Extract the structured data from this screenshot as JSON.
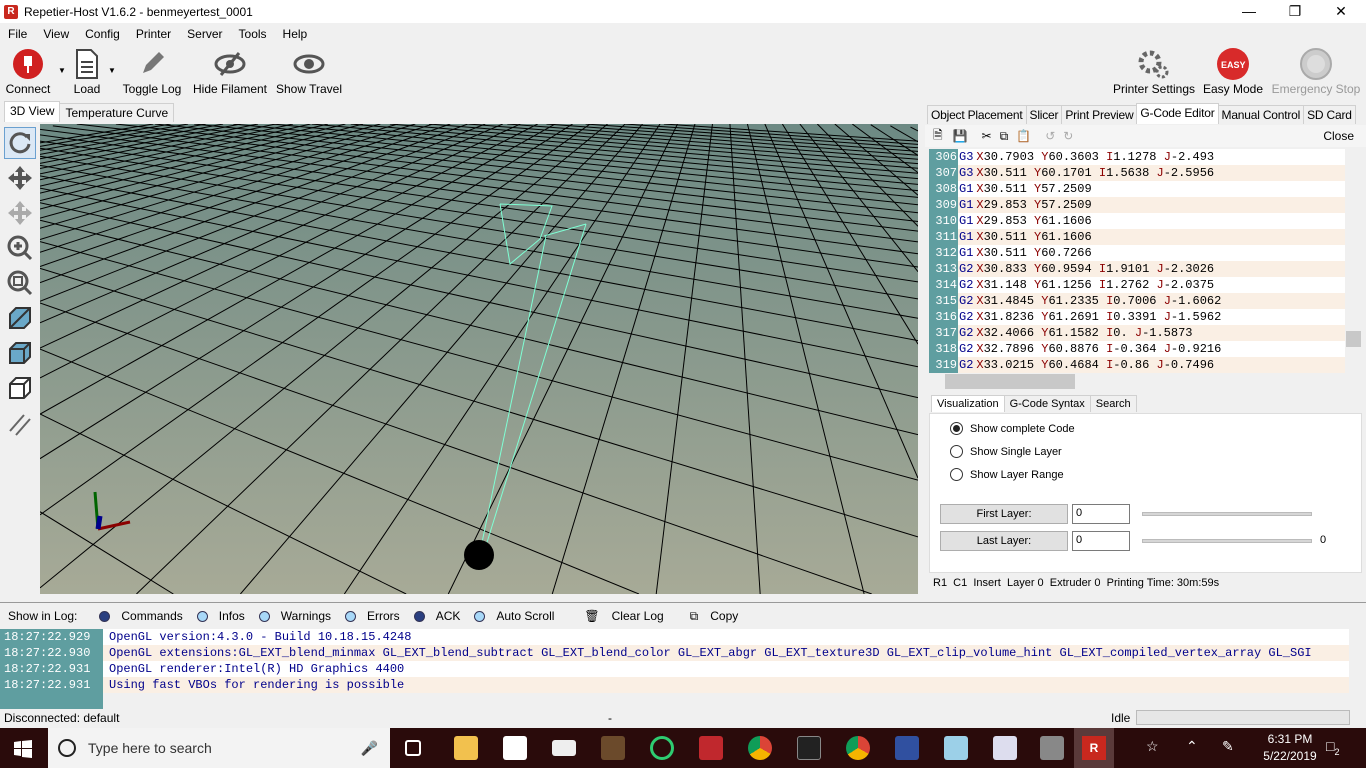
{
  "window": {
    "title": "Repetier-Host V1.6.2 - benmeyertest_0001",
    "app_icon": "R",
    "controls": [
      "minimize",
      "maximize",
      "close"
    ]
  },
  "menu": [
    "File",
    "View",
    "Config",
    "Printer",
    "Server",
    "Tools",
    "Help"
  ],
  "toolbar": {
    "connect": "Connect",
    "load": "Load",
    "toggle_log": "Toggle Log",
    "hide_filament": "Hide Filament",
    "show_travel": "Show Travel",
    "printer_settings": "Printer Settings",
    "easy_mode": "Easy Mode",
    "easy_badge": "EASY",
    "emergency_stop": "Emergency Stop"
  },
  "left_tabs": [
    "3D View",
    "Temperature Curve"
  ],
  "right_tabs": [
    "Object Placement",
    "Slicer",
    "Print Preview",
    "G-Code Editor",
    "Manual Control",
    "SD Card"
  ],
  "editor": {
    "close": "Close",
    "lines": [
      {
        "n": "306",
        "g": "G3",
        "p": [
          [
            "X",
            "30.7903"
          ],
          [
            "Y",
            "60.3603"
          ],
          [
            "I",
            "1.1278"
          ],
          [
            "J",
            "-2.493"
          ]
        ]
      },
      {
        "n": "307",
        "g": "G3",
        "p": [
          [
            "X",
            "30.511"
          ],
          [
            "Y",
            "60.1701"
          ],
          [
            "I",
            "1.5638"
          ],
          [
            "J",
            "-2.5956"
          ]
        ]
      },
      {
        "n": "308",
        "g": "G1",
        "p": [
          [
            "X",
            "30.511"
          ],
          [
            "Y",
            "57.2509"
          ]
        ]
      },
      {
        "n": "309",
        "g": "G1",
        "p": [
          [
            "X",
            "29.853"
          ],
          [
            "Y",
            "57.2509"
          ]
        ]
      },
      {
        "n": "310",
        "g": "G1",
        "p": [
          [
            "X",
            "29.853"
          ],
          [
            "Y",
            "61.1606"
          ]
        ]
      },
      {
        "n": "311",
        "g": "G1",
        "p": [
          [
            "X",
            "30.511"
          ],
          [
            "Y",
            "61.1606"
          ]
        ]
      },
      {
        "n": "312",
        "g": "G1",
        "p": [
          [
            "X",
            "30.511"
          ],
          [
            "Y",
            "60.7266"
          ]
        ]
      },
      {
        "n": "313",
        "g": "G2",
        "p": [
          [
            "X",
            "30.833"
          ],
          [
            "Y",
            "60.9594"
          ],
          [
            "I",
            "1.9101"
          ],
          [
            "J",
            "-2.3026"
          ]
        ]
      },
      {
        "n": "314",
        "g": "G2",
        "p": [
          [
            "X",
            "31.148"
          ],
          [
            "Y",
            "61.1256"
          ],
          [
            "I",
            "1.2762"
          ],
          [
            "J",
            "-2.0375"
          ]
        ]
      },
      {
        "n": "315",
        "g": "G2",
        "p": [
          [
            "X",
            "31.4845"
          ],
          [
            "Y",
            "61.2335"
          ],
          [
            "I",
            "0.7006"
          ],
          [
            "J",
            "-1.6062"
          ]
        ]
      },
      {
        "n": "316",
        "g": "G2",
        "p": [
          [
            "X",
            "31.8236"
          ],
          [
            "Y",
            "61.2691"
          ],
          [
            "I",
            "0.3391"
          ],
          [
            "J",
            "-1.5962"
          ]
        ]
      },
      {
        "n": "317",
        "g": "G2",
        "p": [
          [
            "X",
            "32.4066"
          ],
          [
            "Y",
            "61.1582"
          ],
          [
            "I",
            "0."
          ],
          [
            "J",
            "-1.5873"
          ]
        ]
      },
      {
        "n": "318",
        "g": "G2",
        "p": [
          [
            "X",
            "32.7896"
          ],
          [
            "Y",
            "60.8876"
          ],
          [
            "I",
            "-0.364"
          ],
          [
            "J",
            "-0.9216"
          ]
        ]
      },
      {
        "n": "319",
        "g": "G2",
        "p": [
          [
            "X",
            "33.0215"
          ],
          [
            "Y",
            "60.4684"
          ],
          [
            "I",
            "-0.86"
          ],
          [
            "J",
            "-0.7496"
          ]
        ]
      }
    ]
  },
  "viz": {
    "tabs": [
      "Visualization",
      "G-Code Syntax",
      "Search"
    ],
    "options": [
      "Show complete Code",
      "Show Single Layer",
      "Show Layer Range"
    ],
    "selected": 0,
    "first_layer_label": "First Layer:",
    "first_layer": "0",
    "last_layer_label": "Last Layer:",
    "last_layer": "0",
    "last_layer_value": "0"
  },
  "editor_status": "R1  C1  Insert  Layer 0  Extruder 0  Printing Time: 30m:59s",
  "log": {
    "label": "Show in Log:",
    "filters": [
      {
        "label": "Commands",
        "on": true
      },
      {
        "label": "Infos",
        "on": false
      },
      {
        "label": "Warnings",
        "on": false
      },
      {
        "label": "Errors",
        "on": false
      },
      {
        "label": "ACK",
        "on": true
      },
      {
        "label": "Auto Scroll",
        "on": false
      }
    ],
    "clear": "Clear Log",
    "copy": "Copy",
    "rows": [
      {
        "t": "18:27:22.929",
        "m": "OpenGL version:4.3.0 - Build 10.18.15.4248"
      },
      {
        "t": "18:27:22.930",
        "m": "OpenGL extensions:GL_EXT_blend_minmax GL_EXT_blend_subtract GL_EXT_blend_color GL_EXT_abgr GL_EXT_texture3D GL_EXT_clip_volume_hint GL_EXT_compiled_vertex_array GL_SGI"
      },
      {
        "t": "18:27:22.931",
        "m": "OpenGL renderer:Intel(R) HD Graphics 4400"
      },
      {
        "t": "18:27:22.931",
        "m": "Using fast VBOs for rendering is possible"
      }
    ]
  },
  "status": {
    "connection": "Disconnected: default",
    "middle": "-",
    "state": "Idle"
  },
  "taskbar": {
    "search_placeholder": "Type here to search",
    "time": "6:31 PM",
    "date": "5/22/2019",
    "notifications": "2"
  }
}
